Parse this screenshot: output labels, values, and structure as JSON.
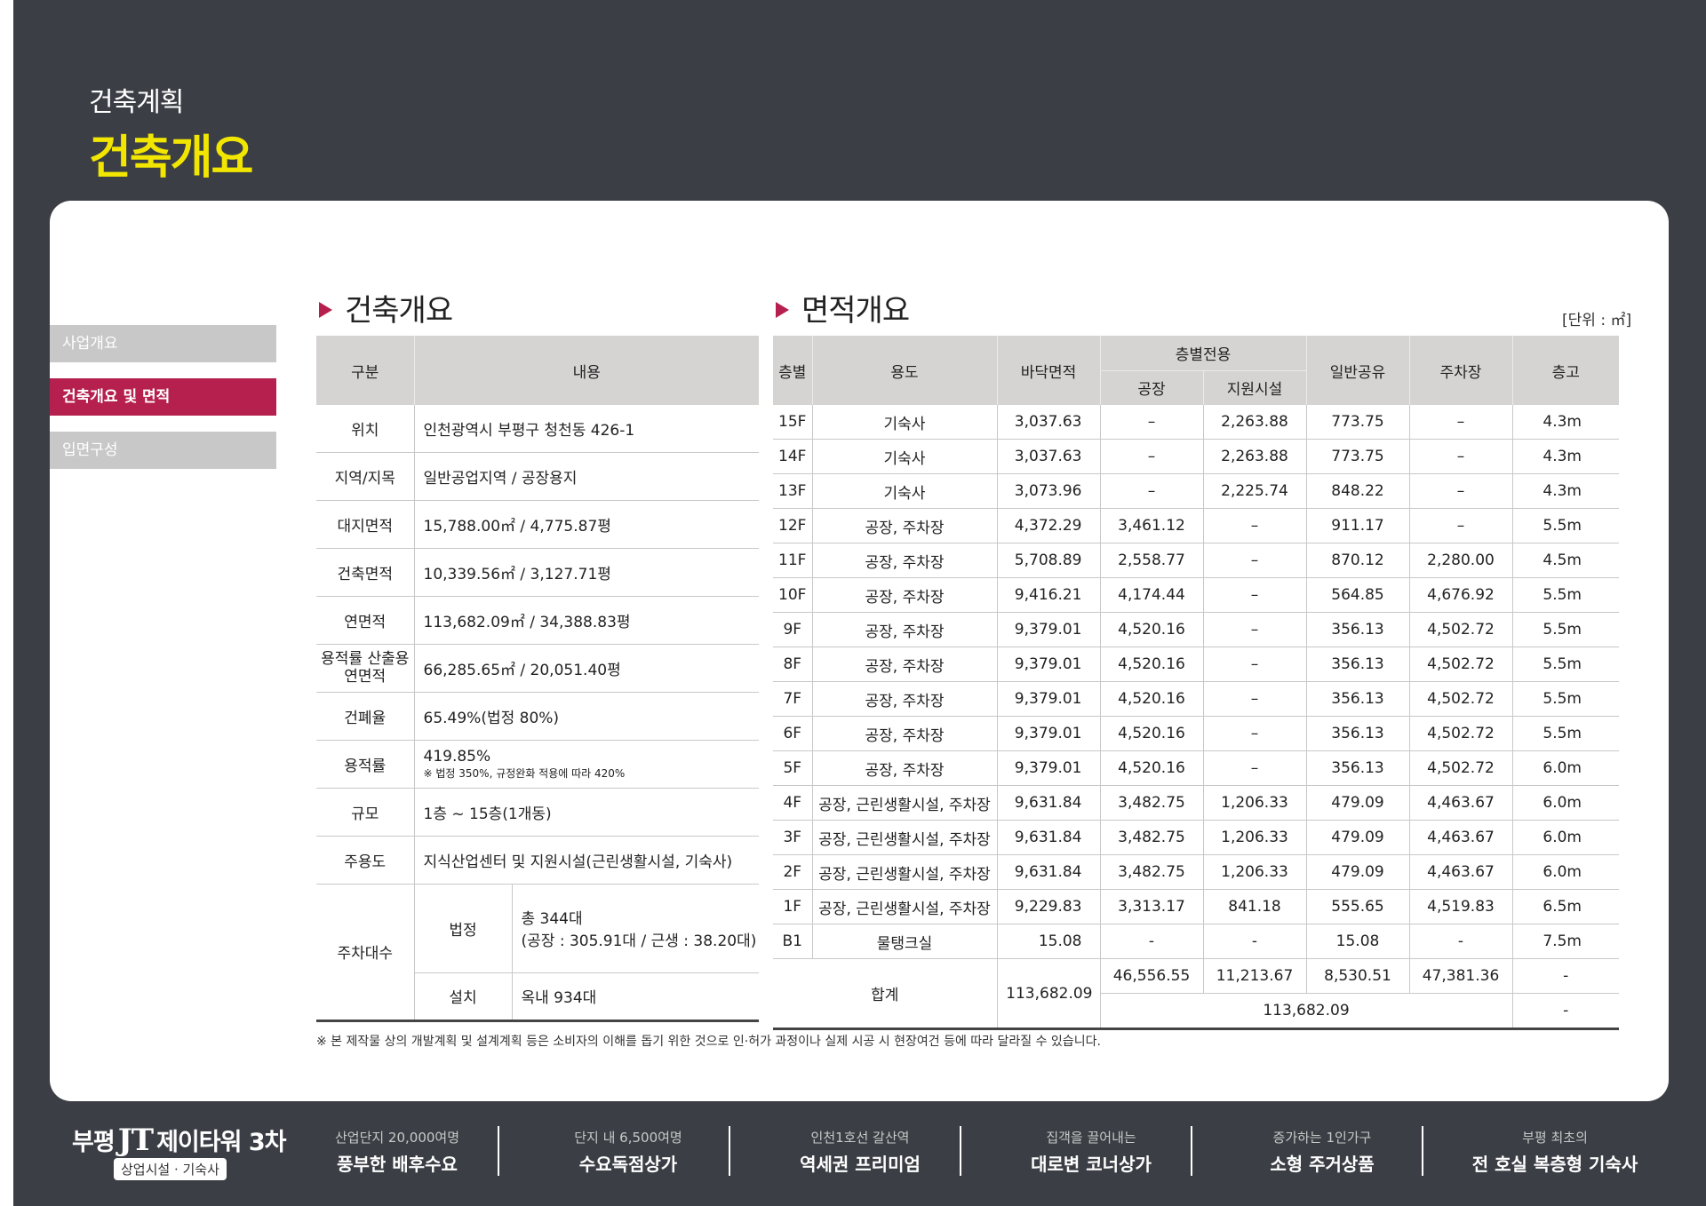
{
  "header": {
    "subtitle": "건축계획",
    "title": "건축개요"
  },
  "sidebar": {
    "items": [
      {
        "label": "사업개요",
        "active": false
      },
      {
        "label": "건축개요 및 면적",
        "active": true
      },
      {
        "label": "입면구성",
        "active": false
      }
    ]
  },
  "building": {
    "title": "건축개요",
    "headers": [
      "구분",
      "내용"
    ],
    "rows": [
      {
        "label": "위치",
        "value": "인천광역시 부평구 청천동 426-1"
      },
      {
        "label": "지역/지목",
        "value": "일반공업지역 / 공장용지"
      },
      {
        "label": "대지면적",
        "value": "15,788.00㎡ / 4,775.87평"
      },
      {
        "label": "건축면적",
        "value": "10,339.56㎡ / 3,127.71평"
      },
      {
        "label": "연면적",
        "value": "113,682.09㎡ / 34,388.83평"
      },
      {
        "label": "용적률 산출용\n연면적",
        "value": "66,285.65㎡ / 20,051.40평"
      },
      {
        "label": "건폐율",
        "value": "65.49%(법정 80%)"
      },
      {
        "label": "용적률",
        "value": "419.85%",
        "note": "※ 법정 350%, 규정완화 적용에 따라 420%"
      },
      {
        "label": "규모",
        "value": "1층 ~ 15층(1개동)"
      },
      {
        "label": "주용도",
        "value": "지식산업센터 및 지원시설(근린생활시설, 기숙사)"
      }
    ],
    "parking": {
      "label": "주차대수",
      "legal_label": "법정",
      "legal_line1": "총 344대",
      "legal_line2": "(공장 : 305.91대 / 근생 : 38.20대)",
      "install_label": "설치",
      "install_value": "옥내 934대"
    }
  },
  "area": {
    "title": "면적개요",
    "unit": "[단위 : ㎡]",
    "headers": {
      "floor": "층별",
      "use": "용도",
      "floor_area": "바닥면적",
      "exclusive": "층별전용",
      "factory": "공장",
      "support": "지원시설",
      "common": "일반공유",
      "parking": "주차장",
      "height": "층고"
    },
    "rows": [
      {
        "floor": "15F",
        "use": "기숙사",
        "area": "3,037.63",
        "factory": "–",
        "support": "2,263.88",
        "common": "773.75",
        "parking": "–",
        "height": "4.3m"
      },
      {
        "floor": "14F",
        "use": "기숙사",
        "area": "3,037.63",
        "factory": "–",
        "support": "2,263.88",
        "common": "773.75",
        "parking": "–",
        "height": "4.3m"
      },
      {
        "floor": "13F",
        "use": "기숙사",
        "area": "3,073.96",
        "factory": "–",
        "support": "2,225.74",
        "common": "848.22",
        "parking": "–",
        "height": "4.3m"
      },
      {
        "floor": "12F",
        "use": "공장, 주차장",
        "area": "4,372.29",
        "factory": "3,461.12",
        "support": "–",
        "common": "911.17",
        "parking": "–",
        "height": "5.5m"
      },
      {
        "floor": "11F",
        "use": "공장, 주차장",
        "area": "5,708.89",
        "factory": "2,558.77",
        "support": "–",
        "common": "870.12",
        "parking": "2,280.00",
        "height": "4.5m"
      },
      {
        "floor": "10F",
        "use": "공장, 주차장",
        "area": "9,416.21",
        "factory": "4,174.44",
        "support": "–",
        "common": "564.85",
        "parking": "4,676.92",
        "height": "5.5m"
      },
      {
        "floor": "9F",
        "use": "공장, 주차장",
        "area": "9,379.01",
        "factory": "4,520.16",
        "support": "–",
        "common": "356.13",
        "parking": "4,502.72",
        "height": "5.5m"
      },
      {
        "floor": "8F",
        "use": "공장, 주차장",
        "area": "9,379.01",
        "factory": "4,520.16",
        "support": "–",
        "common": "356.13",
        "parking": "4,502.72",
        "height": "5.5m"
      },
      {
        "floor": "7F",
        "use": "공장, 주차장",
        "area": "9,379.01",
        "factory": "4,520.16",
        "support": "–",
        "common": "356.13",
        "parking": "4,502.72",
        "height": "5.5m"
      },
      {
        "floor": "6F",
        "use": "공장, 주차장",
        "area": "9,379.01",
        "factory": "4,520.16",
        "support": "–",
        "common": "356.13",
        "parking": "4,502.72",
        "height": "5.5m"
      },
      {
        "floor": "5F",
        "use": "공장, 주차장",
        "area": "9,379.01",
        "factory": "4,520.16",
        "support": "–",
        "common": "356.13",
        "parking": "4,502.72",
        "height": "6.0m"
      },
      {
        "floor": "4F",
        "use": "공장, 근린생활시설, 주차장",
        "area": "9,631.84",
        "factory": "3,482.75",
        "support": "1,206.33",
        "common": "479.09",
        "parking": "4,463.67",
        "height": "6.0m"
      },
      {
        "floor": "3F",
        "use": "공장, 근린생활시설, 주차장",
        "area": "9,631.84",
        "factory": "3,482.75",
        "support": "1,206.33",
        "common": "479.09",
        "parking": "4,463.67",
        "height": "6.0m"
      },
      {
        "floor": "2F",
        "use": "공장, 근린생활시설, 주차장",
        "area": "9,631.84",
        "factory": "3,482.75",
        "support": "1,206.33",
        "common": "479.09",
        "parking": "4,463.67",
        "height": "6.0m"
      },
      {
        "floor": "1F",
        "use": "공장, 근린생활시설, 주차장",
        "area": "9,229.83",
        "factory": "3,313.17",
        "support": "841.18",
        "common": "555.65",
        "parking": "4,519.83",
        "height": "6.5m"
      },
      {
        "floor": "B1",
        "use": "물탱크실",
        "area": "15.08",
        "factory": "-",
        "support": "-",
        "common": "15.08",
        "parking": "-",
        "height": "7.5m"
      }
    ],
    "total": {
      "label": "합계",
      "area": "113,682.09",
      "factory": "46,556.55",
      "support": "11,213.67",
      "common": "8,530.51",
      "parking": "47,381.36",
      "height": "-",
      "sum": "113,682.09",
      "height2": "-"
    }
  },
  "note": "※ 본 제작물 상의 개발계획 및 설계계획 등은 소비자의 이해를 돕기 위한 것으로 인·허가 과정이나 실제 시공 시 현장여건 등에 따라 달라질 수 있습니다.",
  "footer": {
    "brand_prefix": "부평",
    "brand_mark": "JT",
    "brand_name": "제이타워 3차",
    "brand_tag": "상업시설 · 기숙사",
    "items": [
      {
        "sub": "산업단지 20,000여명",
        "main": "풍부한 배후수요"
      },
      {
        "sub": "단지 내 6,500여명",
        "main": "수요독점상가"
      },
      {
        "sub": "인천1호선 갈산역",
        "main": "역세권 프리미엄"
      },
      {
        "sub": "집객을 끌어내는",
        "main": "대로변 코너상가"
      },
      {
        "sub": "증가하는 1인가구",
        "main": "소형 주거상품"
      },
      {
        "sub": "부평 최초의",
        "main": "전 호실 복층형 기숙사"
      }
    ]
  },
  "colors": {
    "background": "#3b3f45",
    "accent": "#b5204e",
    "title_yellow": "#f2e600",
    "header_gray": "#d6d3d3"
  }
}
